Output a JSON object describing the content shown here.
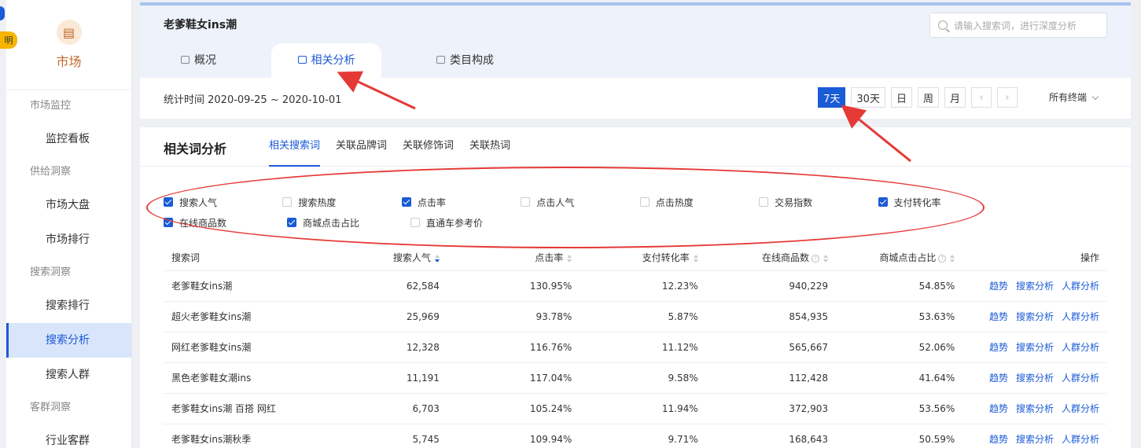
{
  "sidebar": {
    "badge_text": "明",
    "brand_label": "市场",
    "groups": [
      {
        "title": "市场监控",
        "items": [
          {
            "label": "监控看板",
            "active": false
          }
        ]
      },
      {
        "title": "供给洞察",
        "items": [
          {
            "label": "市场大盘",
            "active": false
          },
          {
            "label": "市场排行",
            "active": false
          }
        ]
      },
      {
        "title": "搜索洞察",
        "items": [
          {
            "label": "搜索排行",
            "active": false
          },
          {
            "label": "搜索分析",
            "active": true
          },
          {
            "label": "搜索人群",
            "active": false
          }
        ]
      },
      {
        "title": "客群洞察",
        "items": [
          {
            "label": "行业客群",
            "active": false
          }
        ]
      }
    ]
  },
  "header": {
    "keyword": "老爹鞋女ins潮",
    "search_placeholder": "请输入搜索词，进行深度分析",
    "tabs": [
      {
        "label": "概况",
        "icon": "bag-icon"
      },
      {
        "label": "相关分析",
        "icon": "bag-icon",
        "active": true
      },
      {
        "label": "类目构成",
        "icon": "bag-icon"
      }
    ],
    "stat_time": "统计时间 2020-09-25 ~ 2020-10-01",
    "periods": [
      "7天",
      "30天",
      "日",
      "周",
      "月"
    ],
    "active_period": "7天",
    "prev_arrow": "‹",
    "next_arrow": "›",
    "terminal": "所有终端"
  },
  "panel": {
    "title": "相关词分析",
    "subtabs": [
      "相关搜索词",
      "关联品牌词",
      "关联修饰词",
      "关联热词"
    ],
    "active_subtab": "相关搜索词",
    "filters": [
      [
        {
          "label": "搜索人气",
          "checked": true
        },
        {
          "label": "搜索热度",
          "checked": false
        },
        {
          "label": "点击率",
          "checked": true
        },
        {
          "label": "点击人气",
          "checked": false
        },
        {
          "label": "点击热度",
          "checked": false
        },
        {
          "label": "交易指数",
          "checked": false
        },
        {
          "label": "支付转化率",
          "checked": true
        }
      ],
      [
        {
          "label": "在线商品数",
          "checked": true
        },
        {
          "label": "商城点击占比",
          "checked": true
        },
        {
          "label": "直通车参考价",
          "checked": false
        }
      ]
    ],
    "table": {
      "columns": [
        "搜索词",
        "搜索人气",
        "点击率",
        "支付转化率",
        "在线商品数",
        "商城点击占比",
        "操作"
      ],
      "actions": [
        "趋势",
        "搜索分析",
        "人群分析"
      ],
      "rows": [
        [
          "老爹鞋女ins潮",
          "62,584",
          "130.95%",
          "12.23%",
          "940,229",
          "54.85%"
        ],
        [
          "超火老爹鞋女ins潮",
          "25,969",
          "93.78%",
          "5.87%",
          "854,935",
          "53.63%"
        ],
        [
          "网红老爹鞋女ins潮",
          "12,328",
          "116.76%",
          "11.12%",
          "565,667",
          "52.06%"
        ],
        [
          "黑色老爹鞋女潮ins",
          "11,191",
          "117.04%",
          "9.58%",
          "112,428",
          "41.64%"
        ],
        [
          "老爹鞋女ins潮 百搭 网红",
          "6,703",
          "105.24%",
          "11.94%",
          "372,903",
          "53.56%"
        ],
        [
          "老爹鞋女ins潮秋季",
          "5,745",
          "109.94%",
          "9.71%",
          "168,643",
          "50.59%"
        ]
      ]
    }
  },
  "colors": {
    "accent": "#1a5bd6",
    "annotation": "#e53935",
    "brand": "#c0682a"
  }
}
